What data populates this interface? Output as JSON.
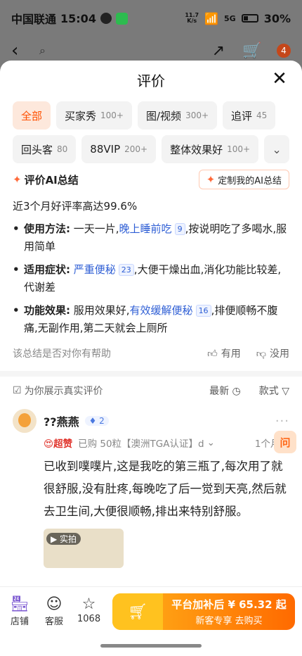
{
  "status": {
    "carrier": "中国联通",
    "time": "15:04",
    "speed_top": "11.7",
    "speed_bottom": "K/s",
    "signal": "5G",
    "battery": "30%"
  },
  "nav": {
    "cart_badge": "4"
  },
  "sheet": {
    "title": "评价"
  },
  "filters": {
    "row1": [
      {
        "label": "全部",
        "count": ""
      },
      {
        "label": "买家秀",
        "count": "100+"
      },
      {
        "label": "图/视频",
        "count": "300+"
      },
      {
        "label": "追评",
        "count": "45"
      }
    ],
    "row2": [
      {
        "label": "回头客",
        "count": "80"
      },
      {
        "label": "88VIP",
        "count": "200+"
      },
      {
        "label": "整体效果好",
        "count": "100+"
      }
    ]
  },
  "ai": {
    "title": "评价AI总结",
    "custom_button": "定制我的AI总结",
    "summary": "近3个月好评率高达99.6%",
    "bullets": [
      {
        "key": "使用方法:",
        "pre": " 一天一片,",
        "hl": "晚上睡前吃",
        "num": "9",
        "post": ",按说明吃了多喝水,服用简单"
      },
      {
        "key": "适用症状:",
        "pre": " ",
        "hl": "严重便秘",
        "num": "23",
        "post": ",大便干燥出血,消化功能比较差,代谢差"
      },
      {
        "key": "功能效果:",
        "pre": " 服用效果好,",
        "hl": "有效缓解便秘",
        "num": "16",
        "post": ",排便顺畅不腹痛,无副作用,第二天就会上厕所"
      }
    ],
    "helpful_question": "该总结是否对你有帮助",
    "useful": "有用",
    "useless": "没用"
  },
  "sortbar": {
    "notice": "为你展示真实评价",
    "latest": "最新",
    "style": "款式"
  },
  "review": {
    "name": "??燕燕",
    "level": "2",
    "tag": "超赞",
    "purchase": "已购 50粒【澳洲TGA认证】d",
    "time": "1个月前",
    "text": "已收到噗噗片,这是我吃的第三瓶了,每次用了就很舒服,没有肚疼,每晚吃了后一觉到天亮,然后就去卫生间,大便很顺畅,排出来特别舒服。",
    "photo_tag": "实拍"
  },
  "float_ask": "问",
  "bottom": {
    "store": "店铺",
    "service": "客服",
    "fav_count": "1068",
    "buy_line1": "平台加补后 ¥ 65.32 起",
    "buy_line2": "新客专享  去购买"
  }
}
